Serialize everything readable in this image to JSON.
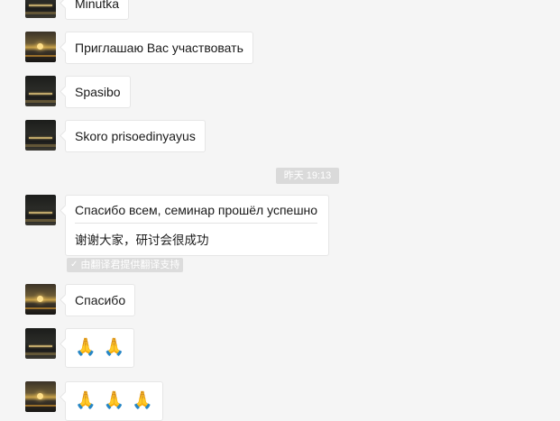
{
  "chat": {
    "timestamp": "昨天 19:13",
    "translation_badge": "由翻译君提供翻译支持",
    "check_glyph": "✓",
    "messages": [
      {
        "text": "Minutka"
      },
      {
        "text": "Приглашаю Вас участвовать"
      },
      {
        "text": "Spasibo"
      },
      {
        "text": "Skoro prisoedinyayus"
      },
      {
        "text": "Спасибо всем, семинар прошёл успешно",
        "translation": "谢谢大家，研讨会很成功"
      },
      {
        "text": "Спасибо"
      },
      {
        "emoji": [
          "🙏",
          "🙏"
        ],
        "emoji_name": "folded-hands"
      },
      {
        "emoji": [
          "🙏",
          "🙏",
          "🙏"
        ],
        "emoji_name": "folded-hands"
      }
    ]
  },
  "colors": {
    "background": "#f5f5f5",
    "bubble": "#ffffff",
    "badge": "#dadada"
  }
}
